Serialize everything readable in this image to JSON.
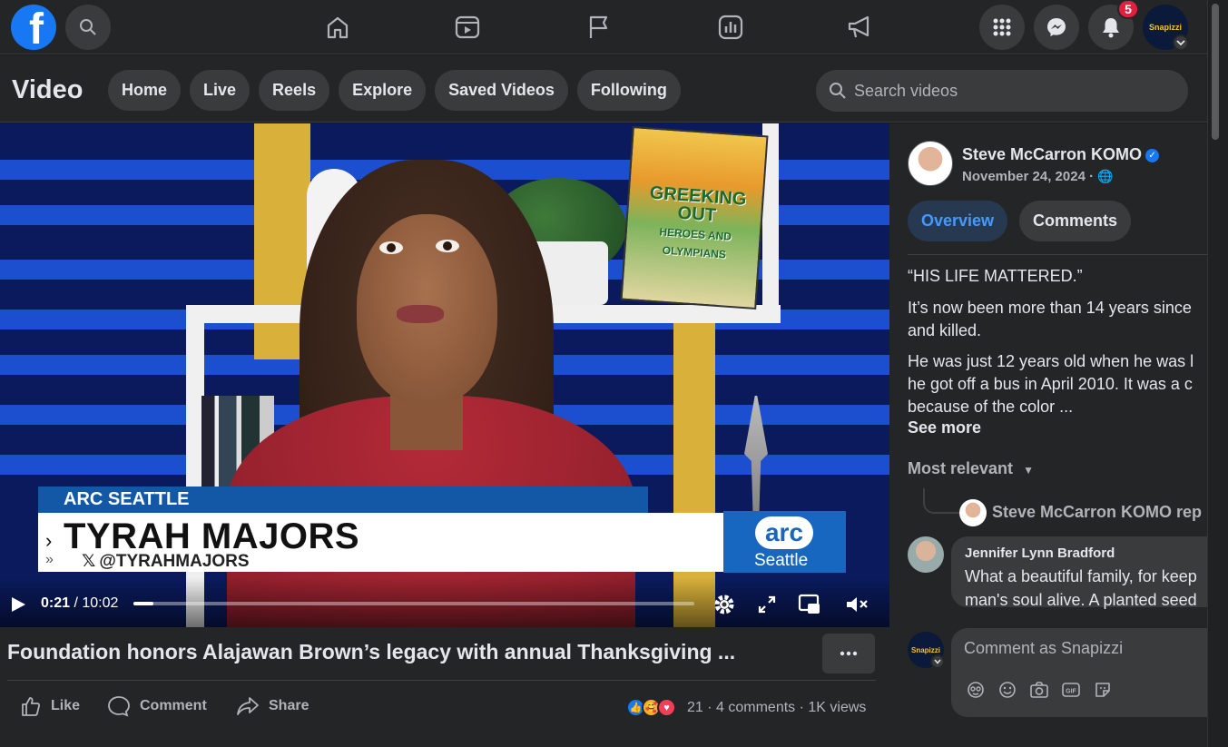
{
  "topbar": {
    "logo_letter": "f",
    "notification_count": "5",
    "profile_avatar_text": "Snapizzi",
    "icons": [
      "facebook-logo-icon",
      "search-icon",
      "home-icon",
      "video-icon",
      "flag-icon",
      "chart-icon",
      "megaphone-icon",
      "grid-menu-icon",
      "messenger-icon",
      "bell-icon"
    ]
  },
  "subheader": {
    "title": "Video",
    "tabs": [
      "Home",
      "Live",
      "Reels",
      "Explore",
      "Saved Videos",
      "Following"
    ],
    "search_placeholder": "Search videos"
  },
  "video": {
    "lower_third_label": "ARC SEATTLE",
    "lower_third_name": "TYRAH MAJORS",
    "lower_third_handle": "@TYRAHMAJORS",
    "logo_top": "arc",
    "logo_bottom": "Seattle",
    "book_title": "GREEKING OUT",
    "book_subtitle": "HEROES AND OLYMPIANS",
    "current_time": "0:21",
    "duration": "10:02",
    "progress_fraction": 0.035
  },
  "post": {
    "title": "Foundation honors Alajawan Brown’s legacy with annual Thanksgiving ...",
    "actions": [
      "Like",
      "Comment",
      "Share"
    ],
    "reaction_count": "21",
    "comments": "4 comments",
    "views": "1K views",
    "stats_sep": "·"
  },
  "panel": {
    "author": "Steve McCarron KOMO",
    "date": "November 24, 2024 ·",
    "tabs": [
      "Overview",
      "Comments"
    ],
    "lines": [
      "“HIS LIFE MATTERED.”",
      "It’s now been more than 14 years since",
      "and killed.",
      "He was just 12 years old when he was l",
      "he got off a bus in April 2010. It was a c",
      "because of the color ..."
    ],
    "see_more": "See more",
    "sort_label": "Most relevant",
    "reply_text": "Steve McCarron KOMO rep",
    "comment_author": "Jennifer Lynn Bradford",
    "comment_line1": "What a beautiful family, for keep",
    "comment_line2": "man's soul alive. A planted seed",
    "composer_placeholder": "Comment as Snapizzi",
    "composer_avatar_text": "Snapizzi"
  },
  "colors": {
    "accent": "#1877f2",
    "badge": "#e41e3f",
    "background": "#18191a",
    "surface": "#242526"
  }
}
